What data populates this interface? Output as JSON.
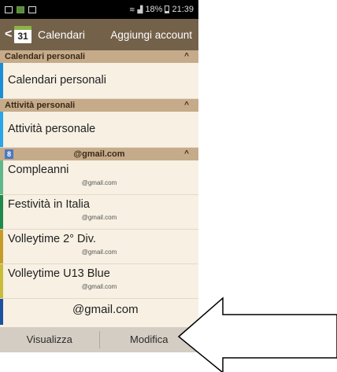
{
  "status_bar": {
    "battery": "18%",
    "time": "21:39"
  },
  "action_bar": {
    "date_badge": "31",
    "title": "Calendari",
    "add_account": "Aggiungi account"
  },
  "sections": {
    "personal_calendars": {
      "header": "Calendari personali",
      "items": [
        {
          "title": "Calendari personali",
          "color": "#1a8fd6"
        }
      ]
    },
    "personal_tasks": {
      "header": "Attività personali",
      "items": [
        {
          "title": "Attività personale",
          "color": "#27a7e8"
        }
      ]
    },
    "account": {
      "badge": "8",
      "header": "@gmail.com",
      "items": [
        {
          "title": "Compleanni",
          "sub": "@gmail.com",
          "color": "#5eb88a"
        },
        {
          "title": "Festività in Italia",
          "sub": "@gmail.com",
          "color": "#1e8a4a"
        },
        {
          "title": "Volleytime 2° Div.",
          "sub": "@gmail.com",
          "color": "#c79b2a"
        },
        {
          "title": "Volleytime U13 Blue",
          "sub": "@gmail.com",
          "color": "#c7bd3a"
        }
      ],
      "partial_item": "@gmail.com"
    }
  },
  "bottom_bar": {
    "view_label": "Visualizza",
    "edit_label": "Modifica"
  },
  "annotation": {
    "arrow_color": "#000000"
  }
}
